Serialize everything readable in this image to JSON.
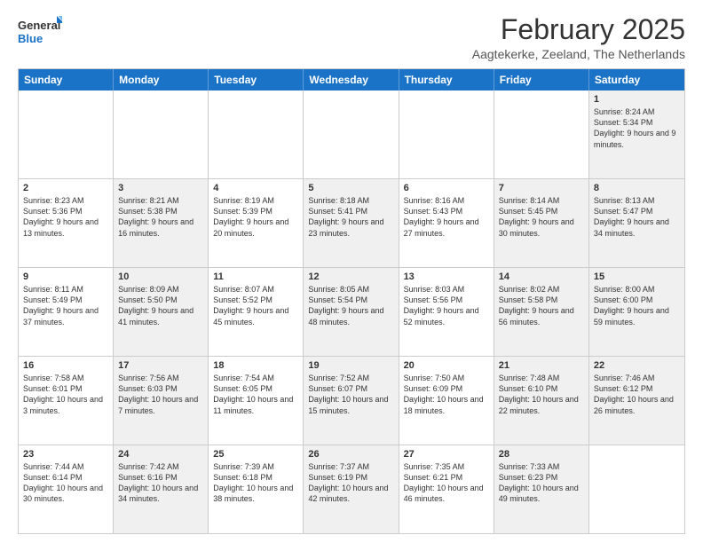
{
  "header": {
    "logo_general": "General",
    "logo_blue": "Blue",
    "month_title": "February 2025",
    "location": "Aagtekerke, Zeeland, The Netherlands"
  },
  "calendar": {
    "days": [
      "Sunday",
      "Monday",
      "Tuesday",
      "Wednesday",
      "Thursday",
      "Friday",
      "Saturday"
    ],
    "rows": [
      [
        {
          "day": "",
          "text": "",
          "empty": true
        },
        {
          "day": "",
          "text": "",
          "empty": true
        },
        {
          "day": "",
          "text": "",
          "empty": true
        },
        {
          "day": "",
          "text": "",
          "empty": true
        },
        {
          "day": "",
          "text": "",
          "empty": true
        },
        {
          "day": "",
          "text": "",
          "empty": true
        },
        {
          "day": "1",
          "text": "Sunrise: 8:24 AM\nSunset: 5:34 PM\nDaylight: 9 hours and 9 minutes.",
          "shaded": true
        }
      ],
      [
        {
          "day": "2",
          "text": "Sunrise: 8:23 AM\nSunset: 5:36 PM\nDaylight: 9 hours and 13 minutes."
        },
        {
          "day": "3",
          "text": "Sunrise: 8:21 AM\nSunset: 5:38 PM\nDaylight: 9 hours and 16 minutes.",
          "shaded": true
        },
        {
          "day": "4",
          "text": "Sunrise: 8:19 AM\nSunset: 5:39 PM\nDaylight: 9 hours and 20 minutes."
        },
        {
          "day": "5",
          "text": "Sunrise: 8:18 AM\nSunset: 5:41 PM\nDaylight: 9 hours and 23 minutes.",
          "shaded": true
        },
        {
          "day": "6",
          "text": "Sunrise: 8:16 AM\nSunset: 5:43 PM\nDaylight: 9 hours and 27 minutes."
        },
        {
          "day": "7",
          "text": "Sunrise: 8:14 AM\nSunset: 5:45 PM\nDaylight: 9 hours and 30 minutes.",
          "shaded": true
        },
        {
          "day": "8",
          "text": "Sunrise: 8:13 AM\nSunset: 5:47 PM\nDaylight: 9 hours and 34 minutes.",
          "shaded": true
        }
      ],
      [
        {
          "day": "9",
          "text": "Sunrise: 8:11 AM\nSunset: 5:49 PM\nDaylight: 9 hours and 37 minutes."
        },
        {
          "day": "10",
          "text": "Sunrise: 8:09 AM\nSunset: 5:50 PM\nDaylight: 9 hours and 41 minutes.",
          "shaded": true
        },
        {
          "day": "11",
          "text": "Sunrise: 8:07 AM\nSunset: 5:52 PM\nDaylight: 9 hours and 45 minutes."
        },
        {
          "day": "12",
          "text": "Sunrise: 8:05 AM\nSunset: 5:54 PM\nDaylight: 9 hours and 48 minutes.",
          "shaded": true
        },
        {
          "day": "13",
          "text": "Sunrise: 8:03 AM\nSunset: 5:56 PM\nDaylight: 9 hours and 52 minutes."
        },
        {
          "day": "14",
          "text": "Sunrise: 8:02 AM\nSunset: 5:58 PM\nDaylight: 9 hours and 56 minutes.",
          "shaded": true
        },
        {
          "day": "15",
          "text": "Sunrise: 8:00 AM\nSunset: 6:00 PM\nDaylight: 9 hours and 59 minutes.",
          "shaded": true
        }
      ],
      [
        {
          "day": "16",
          "text": "Sunrise: 7:58 AM\nSunset: 6:01 PM\nDaylight: 10 hours and 3 minutes."
        },
        {
          "day": "17",
          "text": "Sunrise: 7:56 AM\nSunset: 6:03 PM\nDaylight: 10 hours and 7 minutes.",
          "shaded": true
        },
        {
          "day": "18",
          "text": "Sunrise: 7:54 AM\nSunset: 6:05 PM\nDaylight: 10 hours and 11 minutes."
        },
        {
          "day": "19",
          "text": "Sunrise: 7:52 AM\nSunset: 6:07 PM\nDaylight: 10 hours and 15 minutes.",
          "shaded": true
        },
        {
          "day": "20",
          "text": "Sunrise: 7:50 AM\nSunset: 6:09 PM\nDaylight: 10 hours and 18 minutes."
        },
        {
          "day": "21",
          "text": "Sunrise: 7:48 AM\nSunset: 6:10 PM\nDaylight: 10 hours and 22 minutes.",
          "shaded": true
        },
        {
          "day": "22",
          "text": "Sunrise: 7:46 AM\nSunset: 6:12 PM\nDaylight: 10 hours and 26 minutes.",
          "shaded": true
        }
      ],
      [
        {
          "day": "23",
          "text": "Sunrise: 7:44 AM\nSunset: 6:14 PM\nDaylight: 10 hours and 30 minutes."
        },
        {
          "day": "24",
          "text": "Sunrise: 7:42 AM\nSunset: 6:16 PM\nDaylight: 10 hours and 34 minutes.",
          "shaded": true
        },
        {
          "day": "25",
          "text": "Sunrise: 7:39 AM\nSunset: 6:18 PM\nDaylight: 10 hours and 38 minutes."
        },
        {
          "day": "26",
          "text": "Sunrise: 7:37 AM\nSunset: 6:19 PM\nDaylight: 10 hours and 42 minutes.",
          "shaded": true
        },
        {
          "day": "27",
          "text": "Sunrise: 7:35 AM\nSunset: 6:21 PM\nDaylight: 10 hours and 46 minutes."
        },
        {
          "day": "28",
          "text": "Sunrise: 7:33 AM\nSunset: 6:23 PM\nDaylight: 10 hours and 49 minutes.",
          "shaded": true
        },
        {
          "day": "",
          "text": "",
          "empty": true
        }
      ]
    ]
  }
}
